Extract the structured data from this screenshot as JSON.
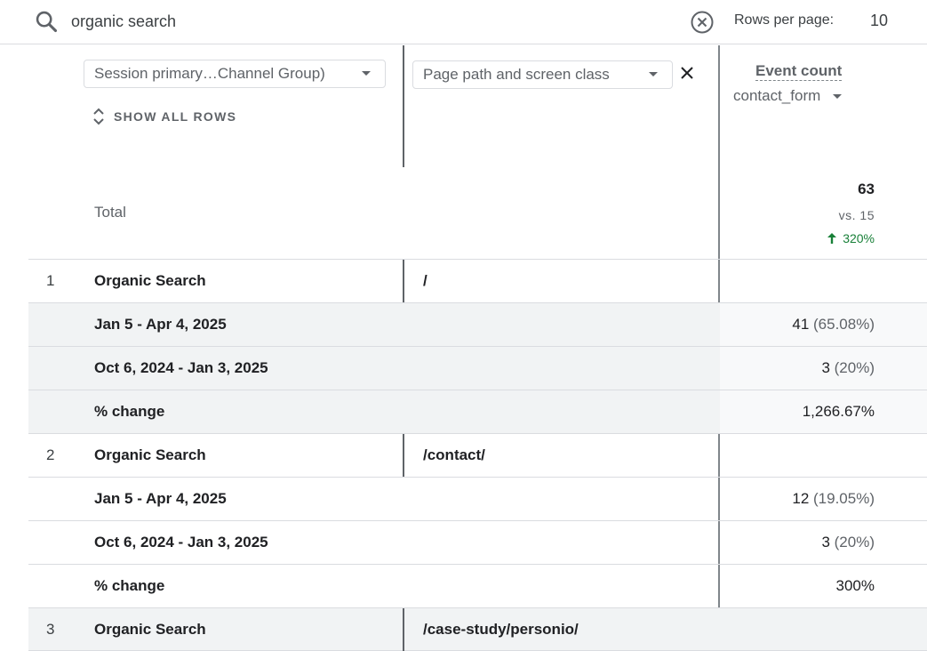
{
  "search": {
    "value": "organic search",
    "placeholder": "Search..."
  },
  "pagination": {
    "rows_label": "Rows per page:",
    "rows_value": "10"
  },
  "header": {
    "dimension_1": "Session primary…Channel Group)",
    "dimension_2": "Page path and screen class",
    "show_all_rows": "SHOW ALL ROWS",
    "metric_name": "Event count",
    "metric_filter": "contact_form"
  },
  "total": {
    "label": "Total",
    "value": "63",
    "vs": "vs. 15",
    "change": "320%"
  },
  "rows": [
    {
      "num": "1",
      "dim1": "Organic Search",
      "dim2": "/"
    },
    {
      "label": "Jan 5 - Apr 4, 2025",
      "value": "41",
      "pct": "(65.08%)"
    },
    {
      "label": "Oct 6, 2024 - Jan 3, 2025",
      "value": "3",
      "pct": "(20%)"
    },
    {
      "label": "% change",
      "value": "1,266.67%"
    },
    {
      "num": "2",
      "dim1": "Organic Search",
      "dim2": "/contact/"
    },
    {
      "label": "Jan 5 - Apr 4, 2025",
      "value": "12",
      "pct": "(19.05%)"
    },
    {
      "label": "Oct 6, 2024 - Jan 3, 2025",
      "value": "3",
      "pct": "(20%)"
    },
    {
      "label": "% change",
      "value": "300%"
    },
    {
      "num": "3",
      "dim1": "Organic Search",
      "dim2": "/case-study/personio/"
    }
  ],
  "colors": {
    "positive_change": "#188038",
    "row_shade": "#f1f3f4",
    "text_muted": "#5f6368"
  }
}
